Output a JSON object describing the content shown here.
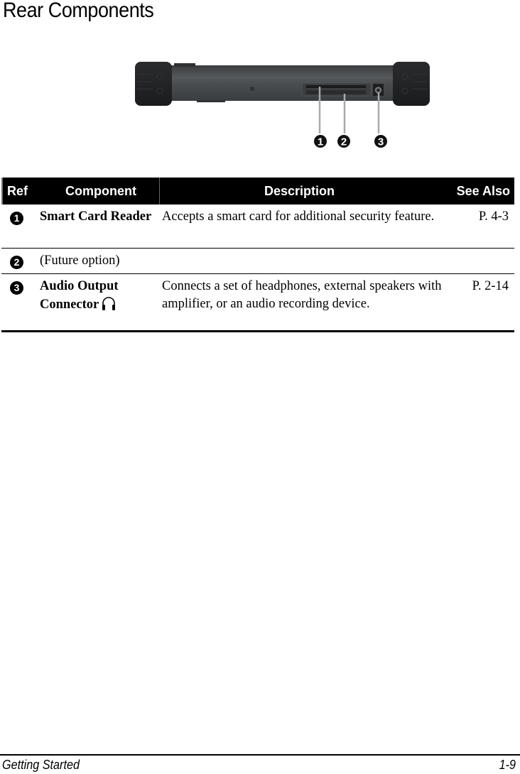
{
  "page": {
    "title": "Rear Components"
  },
  "figure": {
    "callouts": [
      "1",
      "2",
      "3"
    ]
  },
  "table": {
    "headers": {
      "ref": "Ref",
      "component": "Component",
      "description": "Description",
      "see_also": "See Also"
    },
    "rows": [
      {
        "ref": "1",
        "component": "Smart Card Reader",
        "description": "Accepts a smart card for additional security feature.",
        "see_also": "P. 4-3"
      },
      {
        "ref": "2",
        "component": "(Future option)",
        "description": "",
        "see_also": ""
      },
      {
        "ref": "3",
        "component": "Audio Output Connector",
        "component_icon": "headphones-icon",
        "description": "Connects a set of headphones, external speakers with amplifier, or an audio recording device.",
        "see_also": "P. 2-14"
      }
    ]
  },
  "footer": {
    "section": "Getting Started",
    "page_number": "1-9"
  }
}
